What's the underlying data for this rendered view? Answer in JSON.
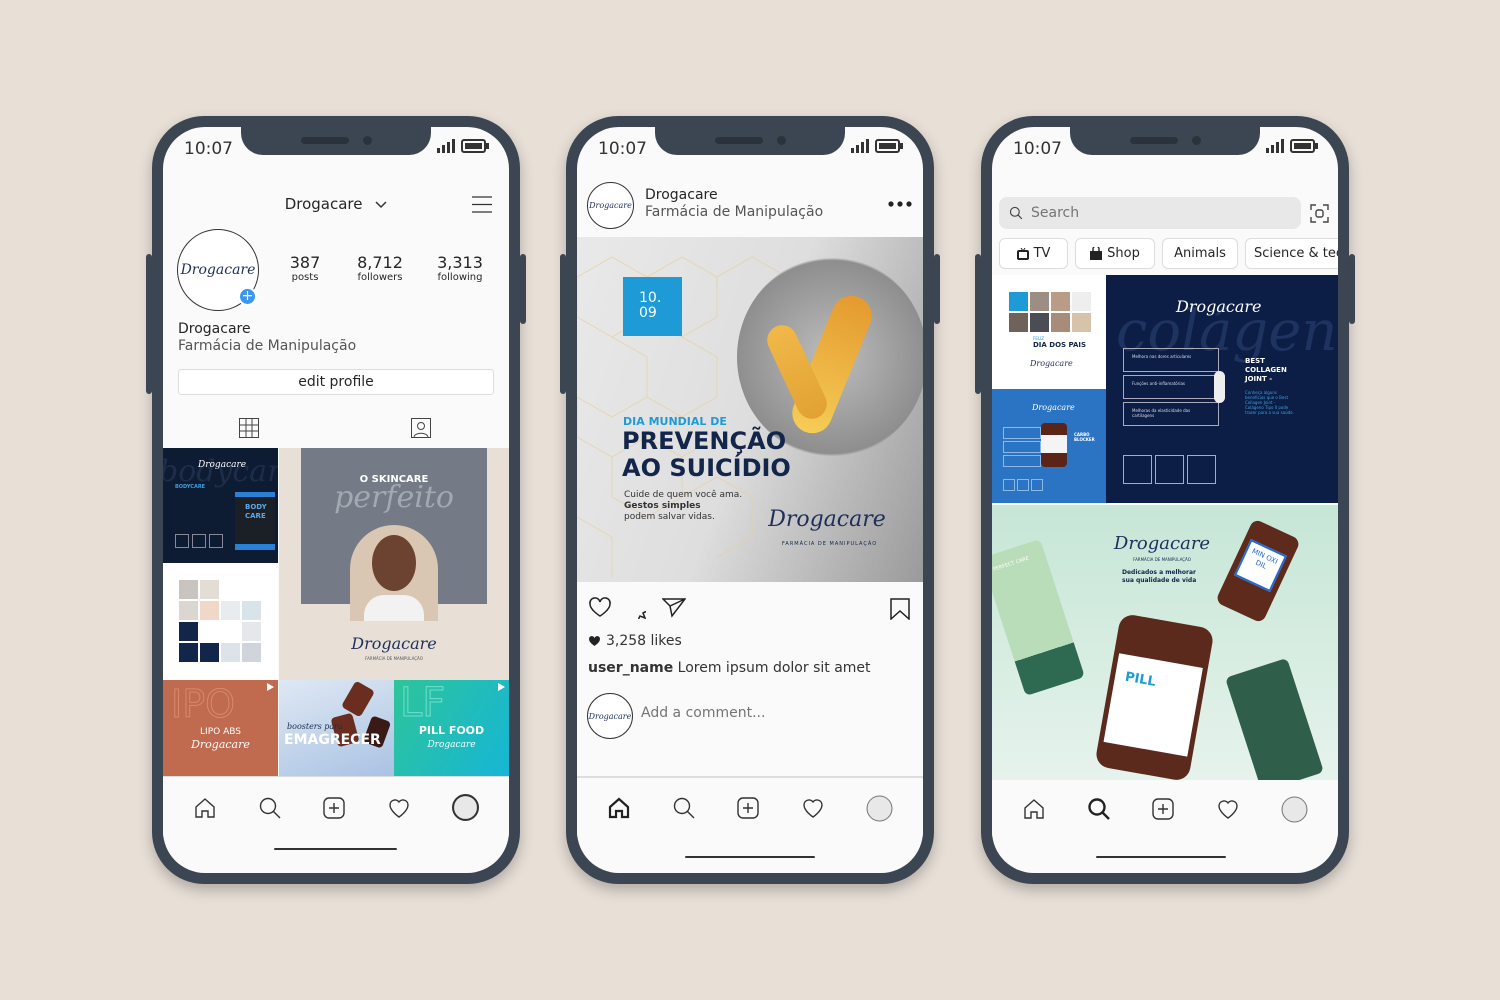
{
  "status": {
    "time": "10:07"
  },
  "profile": {
    "username": "Drogacare",
    "stats": [
      {
        "value": "387",
        "label": "posts"
      },
      {
        "value": "8,712",
        "label": "followers"
      },
      {
        "value": "3,313",
        "label": "following"
      }
    ],
    "name": "Drogacare",
    "bio": "Farmácia de Manipulação",
    "edit_label": "edit profile",
    "avatar_logo": "Drogacare",
    "grid": {
      "bodycare_title": "BODY CARE",
      "bodycare_heading": "BODYCARE",
      "skincare_title": "O SKINCARE",
      "skincare_script": "perfeito",
      "lipo_title": "LIPO ABS",
      "boosters_script": "boosters para",
      "boosters_title": "EMAGRECER",
      "pillfood_title": "PILL FOOD",
      "dedicados": "Dedicados a melhorar sua qualidade de vida",
      "brand_sub": "FARMÁCIA DE MANIPULAÇÃO"
    }
  },
  "post": {
    "account": "Drogacare",
    "subtitle": "Farmácia de Manipulação",
    "image": {
      "date": "10. 09",
      "kicker": "DIA MUNDIAL DE",
      "title_line1": "PREVENÇÃO",
      "title_line2": "AO SUICÍDIO",
      "body1": "Cuide de quem você ama.",
      "body2": "Gestos simples",
      "body3": "podem salvar vidas.",
      "logo": "Drogacare",
      "logo_sub": "FARMÁCIA DE MANIPULAÇÃO"
    },
    "likes": "3,258 likes",
    "caption_user": "user_name",
    "caption_text": "Lorem ipsum dolor sit amet",
    "comment_placeholder": "Add a comment..."
  },
  "explore": {
    "search_placeholder": "Search",
    "chips": [
      {
        "label": "TV",
        "icon": "tv-icon"
      },
      {
        "label": "Shop",
        "icon": "bag-icon"
      },
      {
        "label": "Animals"
      },
      {
        "label": "Science & tec"
      }
    ],
    "tiles": {
      "pais_kicker": "FELIZ",
      "pais_title": "DIA DOS PAIS",
      "collagen_title": "BEST COLLAGEN JOINT -",
      "collagen_text": "Conheça alguns benefícios que o Best Collagen Joint - Colágeno Tipo II pode trazer para a sua saúde.",
      "collagen_boxes": [
        "Melhora nas dores articulares",
        "Funções anti-inflamatórias",
        "Melhoras da elasticidade das cartilagens"
      ],
      "collagen_script": "colágeno",
      "carbo_title": "CARBO BLOCKER",
      "products_tagline": "Dedicados a melhorar sua qualidade de vida",
      "products_brand": "Drogacare",
      "products_sub": "FARMÁCIA DE MANIPULAÇÃO",
      "minoxidil": "MIN OXI DIL",
      "pill": "PILL",
      "perfect_care": "PERFECT CARE"
    }
  },
  "colors": {
    "background": "#e8e0d7",
    "phone": "#3b4652",
    "navy": "#12254a",
    "accent_blue": "#1e9ad6",
    "avatar_plus": "#3897f0"
  }
}
